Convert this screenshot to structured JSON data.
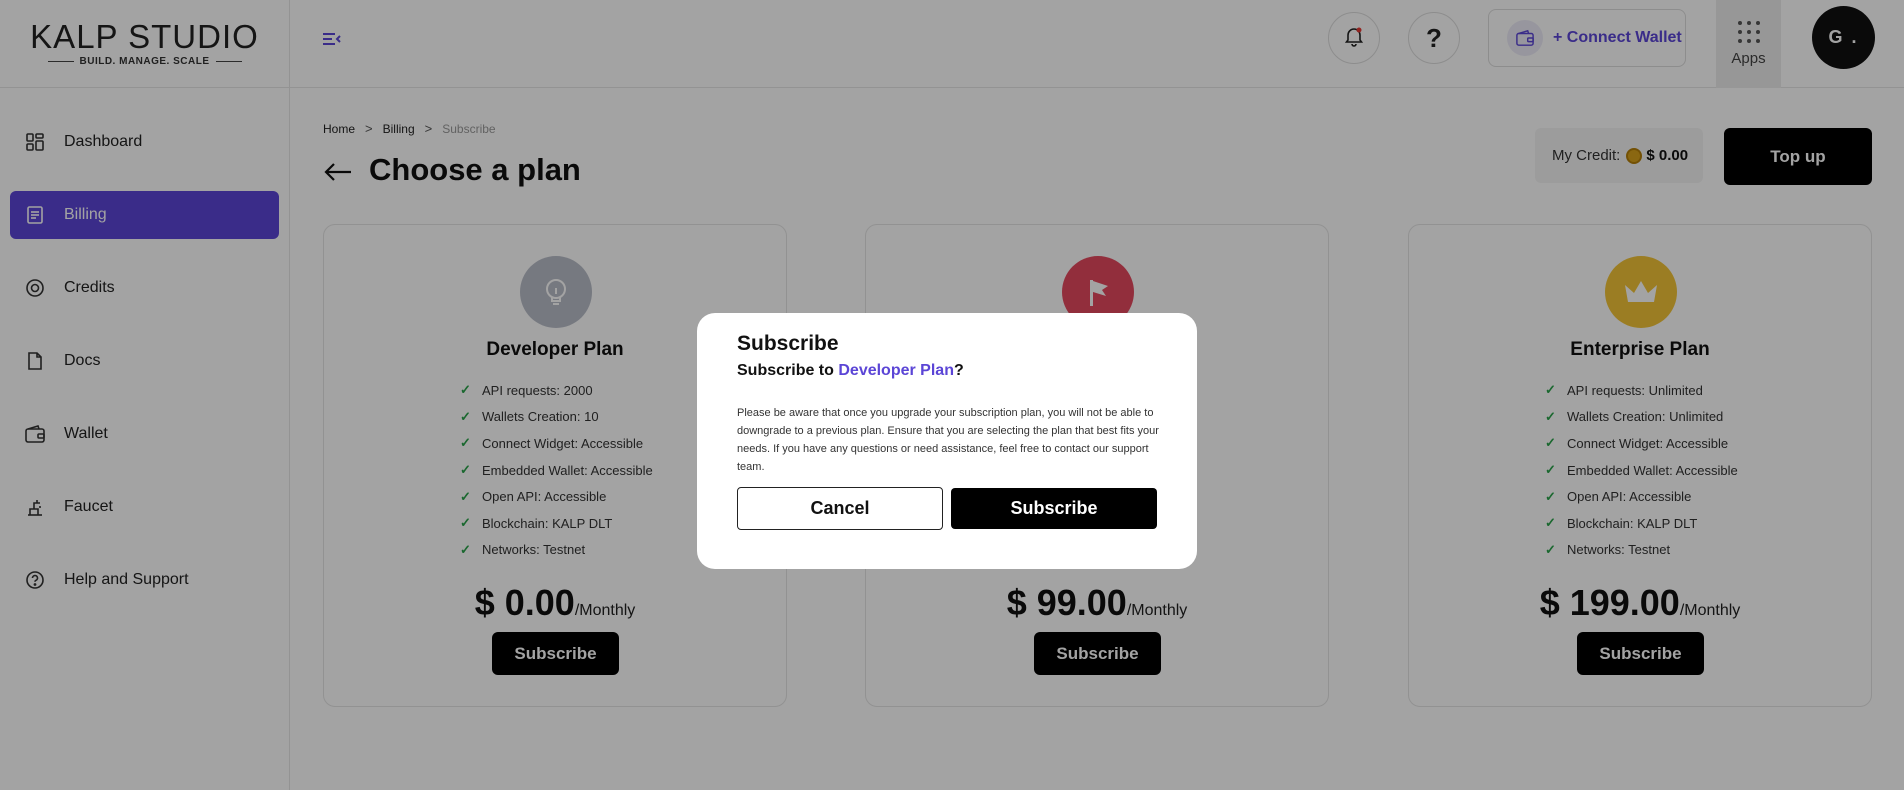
{
  "logo": {
    "brand": "KALP STUDIO",
    "tagline": "BUILD. MANAGE. SCALE"
  },
  "sidebar": {
    "items": [
      {
        "label": "Dashboard",
        "icon": "dashboard-icon",
        "active": false
      },
      {
        "label": "Billing",
        "icon": "billing-icon",
        "active": true
      },
      {
        "label": "Credits",
        "icon": "credits-icon",
        "active": false
      },
      {
        "label": "Docs",
        "icon": "docs-icon",
        "active": false
      },
      {
        "label": "Wallet",
        "icon": "wallet-icon",
        "active": false
      },
      {
        "label": "Faucet",
        "icon": "faucet-icon",
        "active": false
      },
      {
        "label": "Help and Support",
        "icon": "help-icon",
        "active": false
      }
    ]
  },
  "header": {
    "help_label": "?",
    "connect_wallet": "+ Connect Wallet",
    "apps_label": "Apps",
    "avatar": "G ."
  },
  "breadcrumb": {
    "home": "Home",
    "billing": "Billing",
    "current": "Subscribe"
  },
  "page": {
    "title": "Choose a plan"
  },
  "credit": {
    "label": "My Credit:",
    "amount": "$ 0.00"
  },
  "topup_label": "Top up",
  "plans": [
    {
      "name": "Developer Plan",
      "price": "$ 0.00",
      "period": "/Monthly",
      "button": "Subscribe",
      "badge_color": "#b9bdc9",
      "features": [
        "API requests: 2000",
        "Wallets Creation: 10",
        "Connect Widget: Accessible",
        "Embedded Wallet: Accessible",
        "Open API: Accessible",
        "Blockchain: KALP DLT",
        "Networks: Testnet"
      ]
    },
    {
      "name": "",
      "price": "$ 99.00",
      "period": "/Monthly",
      "button": "Subscribe",
      "badge_color": "#e5495f",
      "features": []
    },
    {
      "name": "Enterprise Plan",
      "price": "$ 199.00",
      "period": "/Monthly",
      "button": "Subscribe",
      "badge_color": "#f2c437",
      "features": [
        "API requests: Unlimited",
        "Wallets Creation: Unlimited",
        "Connect Widget: Accessible",
        "Embedded Wallet: Accessible",
        "Open API: Accessible",
        "Blockchain: KALP DLT",
        "Networks: Testnet"
      ]
    }
  ],
  "modal": {
    "title": "Subscribe",
    "question_prefix": "Subscribe to ",
    "question_plan": "Developer Plan",
    "question_suffix": "?",
    "message": "Please be aware that once you upgrade your subscription plan, you will not be able to downgrade to a previous plan. Ensure that you are selecting the plan that best fits your needs. If you have any questions or need assistance, feel free to contact our support team.",
    "cancel_label": "Cancel",
    "subscribe_label": "Subscribe"
  },
  "colors": {
    "accent": "#5b45d6",
    "primary_button": "#000000",
    "check": "#2aa34a"
  }
}
